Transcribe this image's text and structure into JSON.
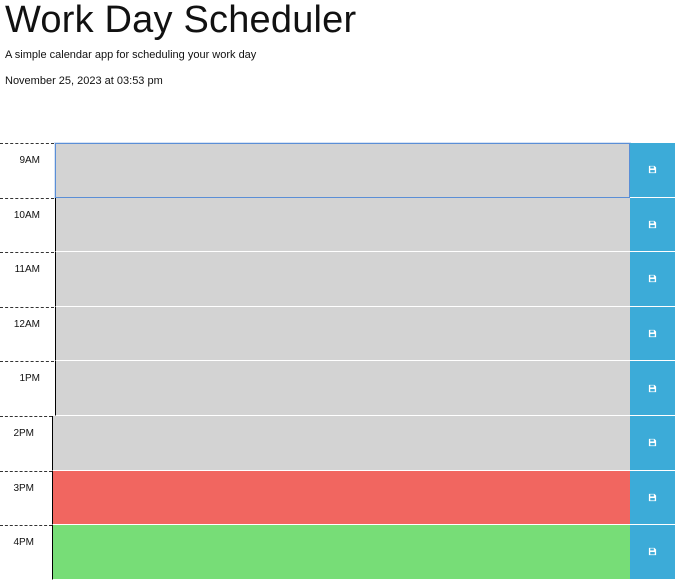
{
  "header": {
    "title": "Work Day Scheduler",
    "subtitle": "A simple calendar app for scheduling your work day",
    "current_datetime": "November 25, 2023 at 03:53 pm"
  },
  "colors": {
    "past": "#d3d3d3",
    "present": "#f16660",
    "future": "#77dd77",
    "save_button": "#3cabd8"
  },
  "save_icon": "floppy-disk-icon",
  "time_blocks": [
    {
      "hour": "9AM",
      "description": "",
      "state": "past"
    },
    {
      "hour": "10AM",
      "description": "",
      "state": "past"
    },
    {
      "hour": "11AM",
      "description": "",
      "state": "past"
    },
    {
      "hour": "12AM",
      "description": "",
      "state": "past"
    },
    {
      "hour": "1PM",
      "description": "",
      "state": "past"
    },
    {
      "hour": "2PM",
      "description": "",
      "state": "past"
    },
    {
      "hour": "3PM",
      "description": "",
      "state": "present"
    },
    {
      "hour": "4PM",
      "description": "",
      "state": "future"
    }
  ]
}
